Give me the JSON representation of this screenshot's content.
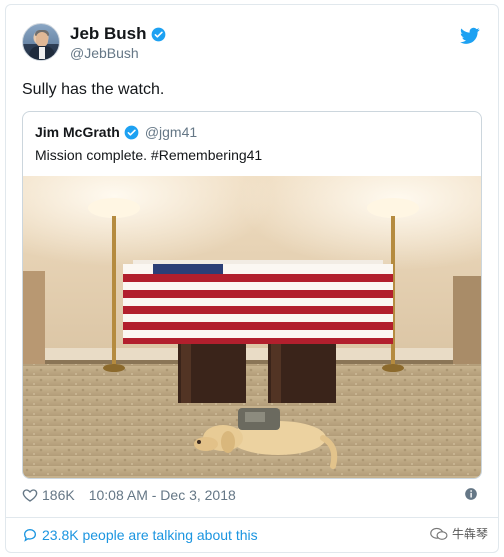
{
  "tweet": {
    "author_name": "Jeb Bush",
    "author_handle": "@JebBush",
    "text": "Sully has the watch.",
    "likes": "186K",
    "timestamp": "10:08 AM - Dec 3, 2018",
    "talking": "23.8K people are talking about this"
  },
  "quoted": {
    "author_name": "Jim McGrath",
    "author_handle": "@jgm41",
    "text": "Mission complete. #Remembering41"
  },
  "watermark": {
    "text": "牛犇琴"
  },
  "colors": {
    "accent": "#1da1f2",
    "link": "#1b95e0",
    "muted": "#657786",
    "text": "#14171a"
  },
  "icons": {
    "verified": "verified-badge-icon",
    "brand": "twitter-bird-icon",
    "like": "heart-icon",
    "info": "info-icon",
    "talk": "speech-bubble-icon"
  }
}
